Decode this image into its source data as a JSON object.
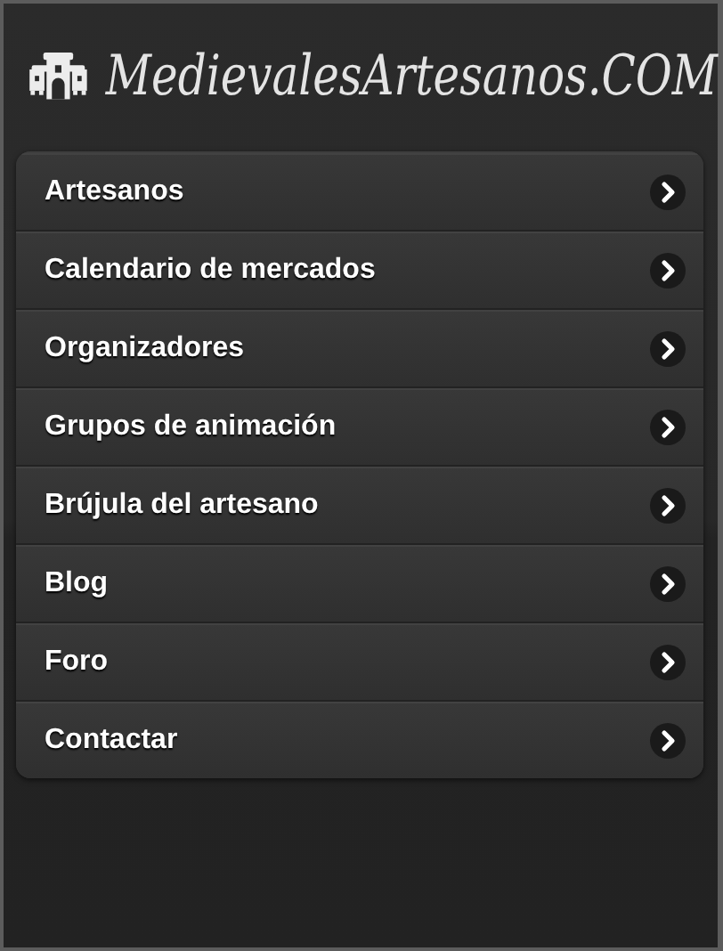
{
  "header": {
    "logo_text": "MedievalesArtesanos.COM"
  },
  "menu": {
    "items": [
      {
        "label": "Artesanos"
      },
      {
        "label": "Calendario de mercados"
      },
      {
        "label": "Organizadores"
      },
      {
        "label": "Grupos de animación"
      },
      {
        "label": "Brújula del artesano"
      },
      {
        "label": "Blog"
      },
      {
        "label": "Foro"
      },
      {
        "label": "Contactar"
      }
    ]
  }
}
